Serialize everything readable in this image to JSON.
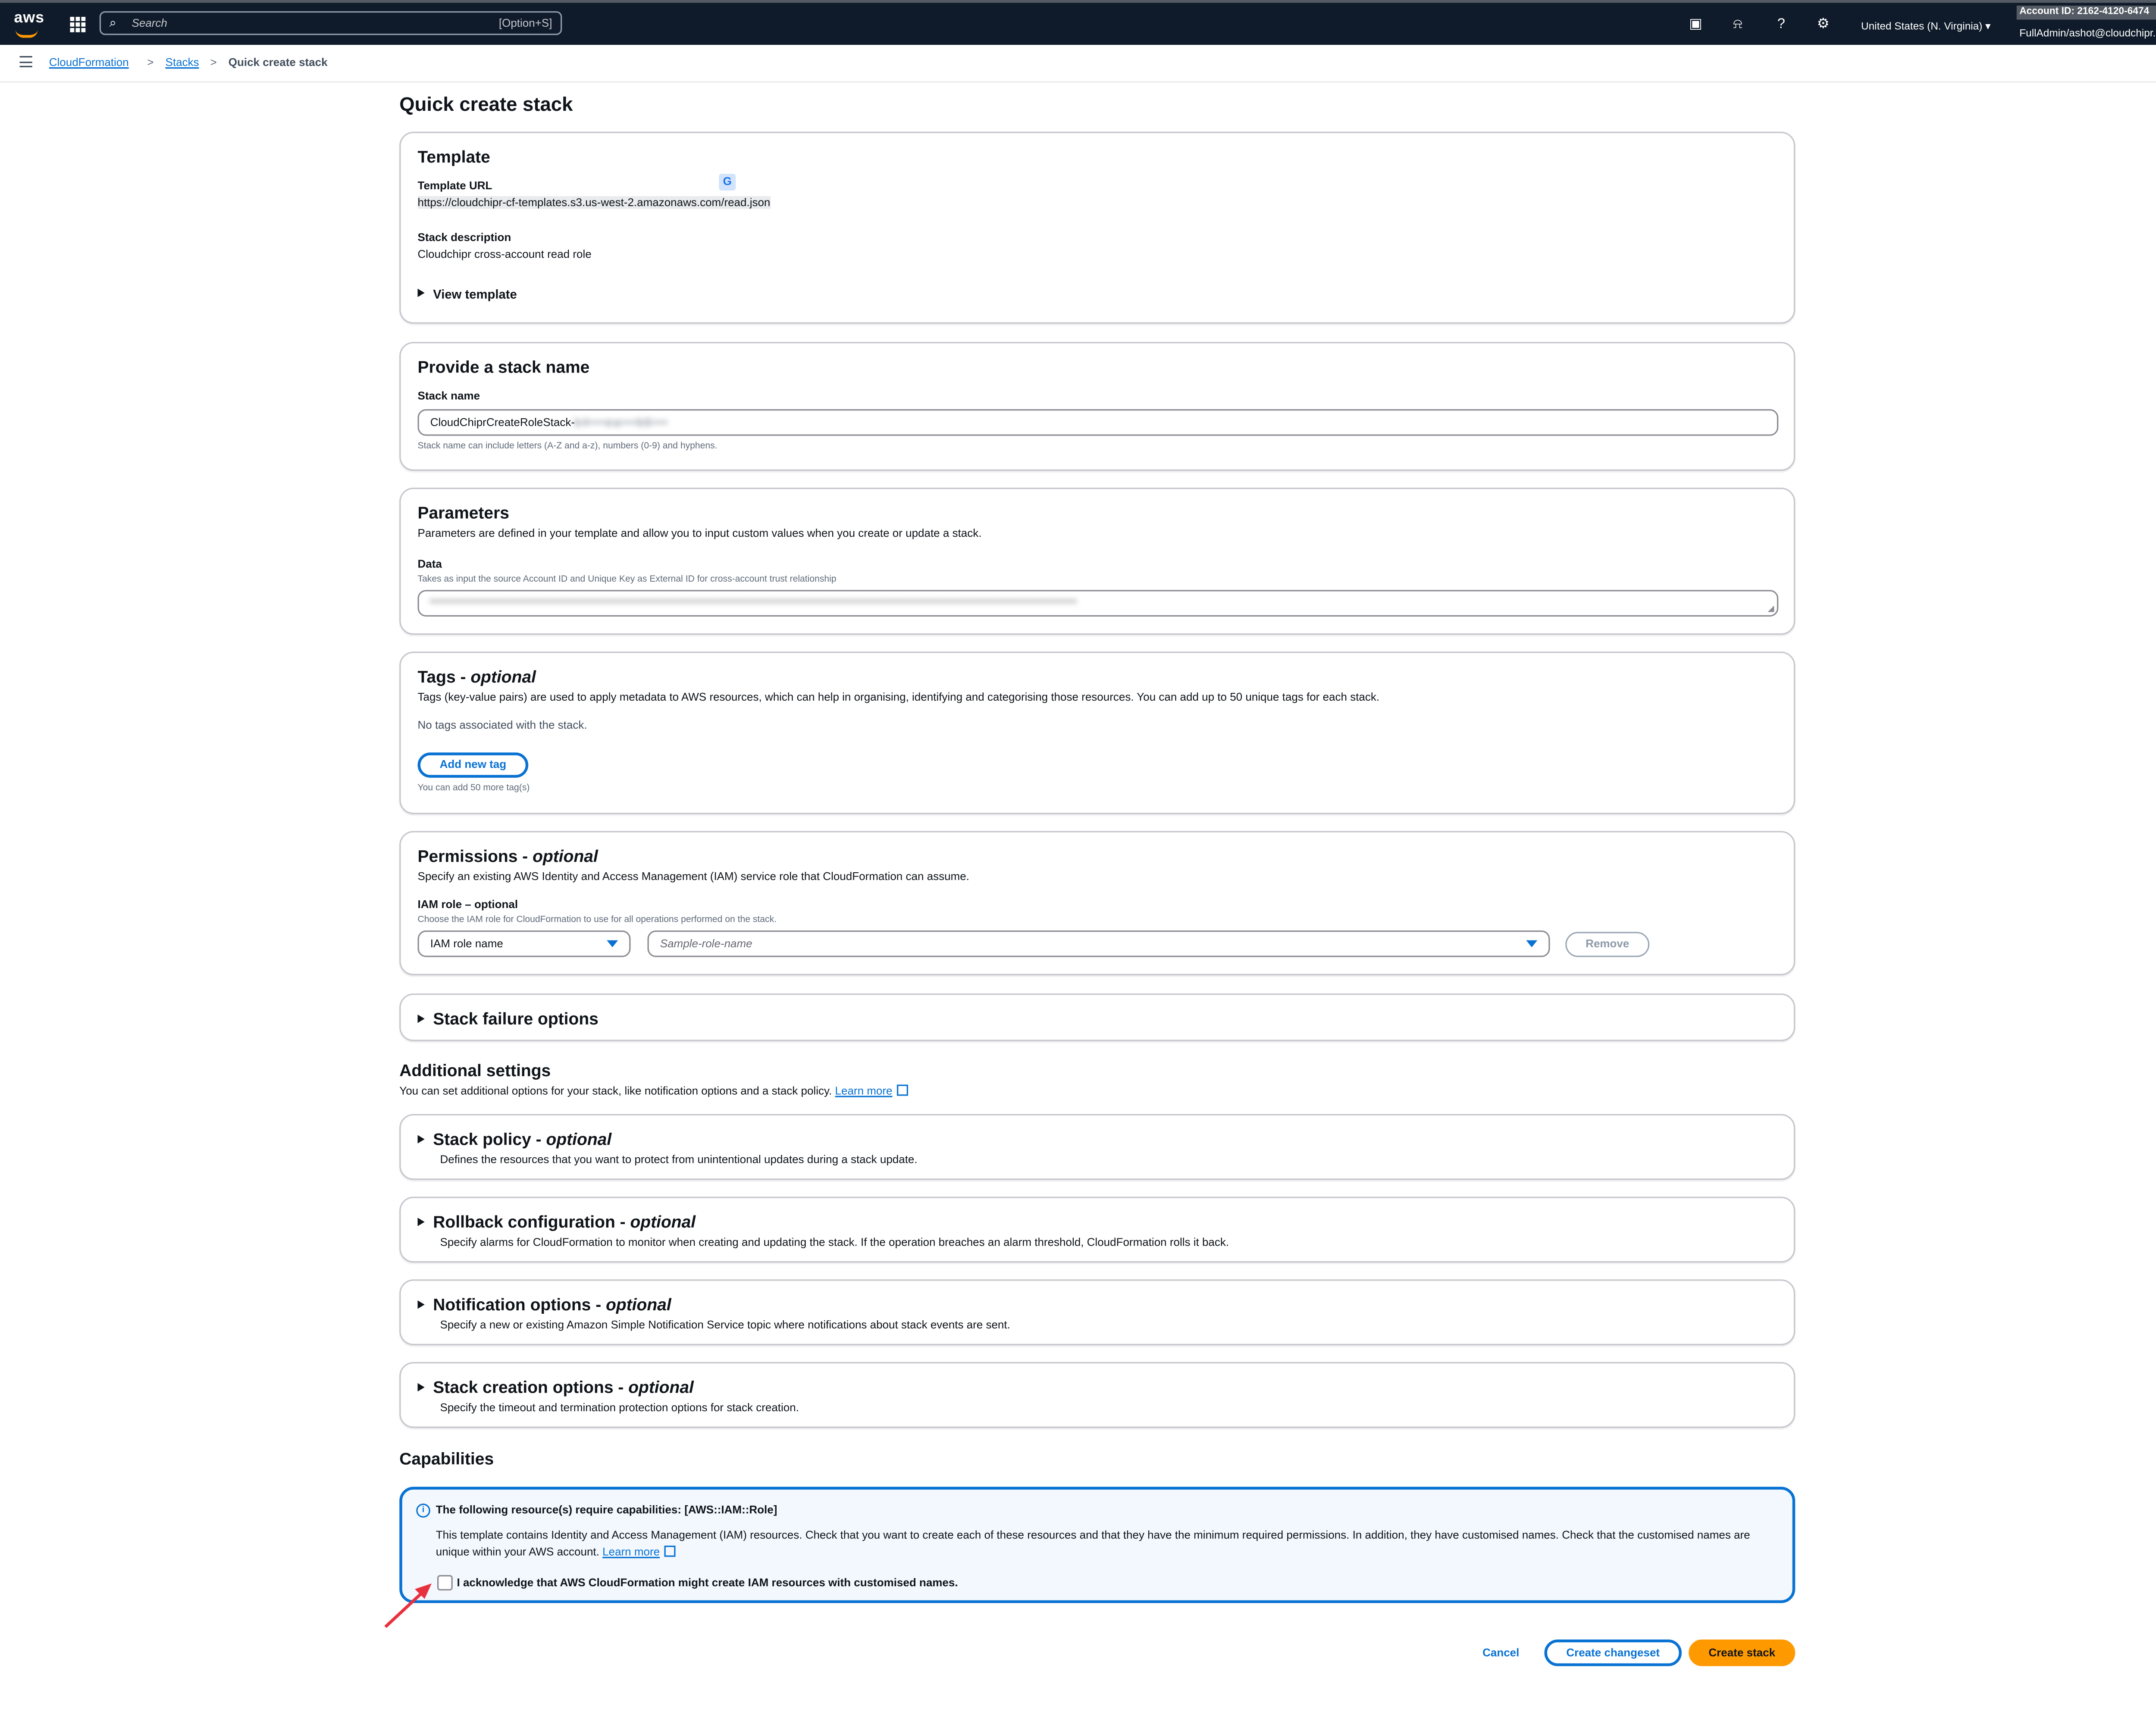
{
  "topbar": {
    "logo": "aws",
    "search_placeholder": "Search",
    "search_shortcut": "[Option+S]",
    "region": "United States (N. Virginia)",
    "account": "Account ID: 2162-4120-6474",
    "user": "FullAdmin/ashot@cloudchipr.com",
    "icons": [
      "cloudshell-icon",
      "bell-icon",
      "help-icon",
      "gear-icon"
    ]
  },
  "breadcrumb": {
    "items": [
      "CloudFormation",
      "Stacks",
      "Quick create stack"
    ],
    "separator": ">"
  },
  "page": {
    "title": "Quick create stack"
  },
  "template": {
    "title": "Template",
    "url_label": "Template URL",
    "url": "https://cloudchipr-cf-templates.s3.us-west-2.amazonaws.com/read.json",
    "desc_label": "Stack description",
    "desc": "Cloudchipr cross-account read role",
    "view_template": "View template"
  },
  "stack_name": {
    "title": "Provide a stack name",
    "label": "Stack name",
    "value_prefix": "CloudChiprCreateRoleStack-",
    "value_redacted": "b4•••ea•••b6•••",
    "hint": "Stack name can include letters (A-Z and a-z), numbers (0-9) and hyphens."
  },
  "parameters": {
    "title": "Parameters",
    "desc": "Parameters are defined in your template and allow you to input custom values when you create or update a stack.",
    "data_label": "Data",
    "data_hint": "Takes as input the source Account ID and Unique Key as External ID for cross-account trust relationship",
    "data_value_redacted": "•••••••••••••••••••••••••••••••••••••••••••••••••••••••••••••••••••••••••••••••••••••••••••••••••••••••••••••••••••••••••••••••••••••••••••••••••••••"
  },
  "tags": {
    "title": "Tags",
    "optional": "optional",
    "desc": "Tags (key-value pairs) are used to apply metadata to AWS resources, which can help in organising, identifying and categorising those resources. You can add up to 50 unique tags for each stack.",
    "empty": "No tags associated with the stack.",
    "add_button": "Add new tag",
    "hint": "You can add 50 more tag(s)"
  },
  "permissions": {
    "title": "Permissions",
    "optional": "optional",
    "desc": "Specify an existing AWS Identity and Access Management (IAM) service role that CloudFormation can assume.",
    "role_label": "IAM role – optional",
    "role_hint": "Choose the IAM role for CloudFormation to use for all operations performed on the stack.",
    "role_type": "IAM role name",
    "role_placeholder": "Sample-role-name",
    "remove_button": "Remove"
  },
  "failure_options": {
    "title": "Stack failure options"
  },
  "additional": {
    "title": "Additional settings",
    "desc": "You can set additional options for your stack, like notification options and a stack policy.",
    "learn_more": "Learn more",
    "sections": [
      {
        "title": "Stack policy",
        "optional": "optional",
        "desc": "Defines the resources that you want to protect from unintentional updates during a stack update."
      },
      {
        "title": "Rollback configuration",
        "optional": "optional",
        "desc": "Specify alarms for CloudFormation to monitor when creating and updating the stack. If the operation breaches an alarm threshold, CloudFormation rolls it back."
      },
      {
        "title": "Notification options",
        "optional": "optional",
        "desc": "Specify a new or existing Amazon Simple Notification Service topic where notifications about stack events are sent."
      },
      {
        "title": "Stack creation options",
        "optional": "optional",
        "desc": "Specify the timeout and termination protection options for stack creation."
      }
    ]
  },
  "capabilities": {
    "title": "Capabilities",
    "alert_title": "The following resource(s) require capabilities: [AWS::IAM::Role]",
    "alert_body": "This template contains Identity and Access Management (IAM) resources. Check that you want to create each of these resources and that they have the minimum required permissions. In addition, they have customised names. Check that the customised names are unique within your AWS account.",
    "learn_more": "Learn more",
    "ack": "I acknowledge that AWS CloudFormation might create IAM resources with customised names.",
    "ack_checked": false
  },
  "footer": {
    "cancel": "Cancel",
    "changeset": "Create changeset",
    "create": "Create stack"
  },
  "colors": {
    "accent": "#0972d3",
    "primary_button": "#ff9900",
    "topbar": "#0f1b2a",
    "annotation_arrow": "#e8313f"
  }
}
